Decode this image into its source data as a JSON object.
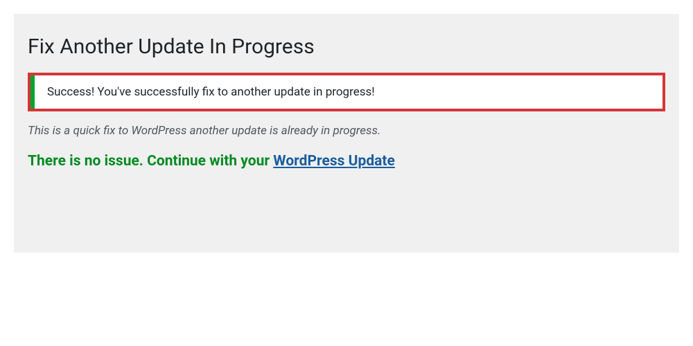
{
  "page": {
    "title": "Fix Another Update In Progress"
  },
  "notice": {
    "message": "Success! You've successfully fix to another update in progress!"
  },
  "description": "This is a quick fix to WordPress another update is already in progress.",
  "status": {
    "text_before_link": "There is no issue. Continue with your ",
    "link_text": "WordPress Update"
  },
  "colors": {
    "highlight_border": "#d63638",
    "success_border": "#00a32a",
    "status_text": "#008a20",
    "link": "#1a5d9e",
    "panel_bg": "#f0f0f1"
  }
}
